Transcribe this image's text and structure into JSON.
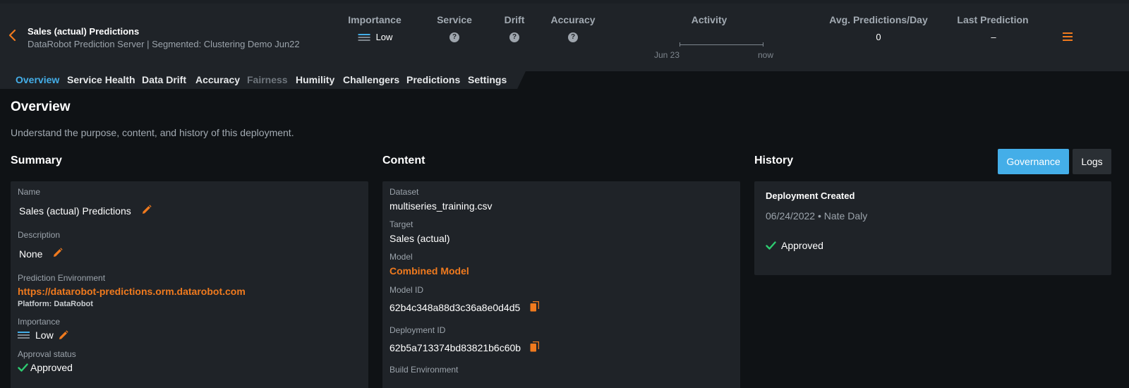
{
  "header": {
    "title": "Sales (actual) Predictions",
    "subtitle": "DataRobot Prediction Server | Segmented: Clustering Demo Jun22",
    "metrics": {
      "importance_label": "Importance",
      "importance_value": "Low",
      "service_label": "Service",
      "drift_label": "Drift",
      "accuracy_label": "Accuracy",
      "activity_label": "Activity",
      "activity_start": "Jun 23",
      "activity_end": "now",
      "avg_label": "Avg. Predictions/Day",
      "avg_value": "0",
      "last_label": "Last Prediction",
      "last_value": "–"
    }
  },
  "tabs": [
    {
      "label": "Overview",
      "state": "active"
    },
    {
      "label": "Service Health",
      "state": "normal"
    },
    {
      "label": "Data Drift",
      "state": "normal"
    },
    {
      "label": "Accuracy",
      "state": "normal"
    },
    {
      "label": "Fairness",
      "state": "disabled"
    },
    {
      "label": "Humility",
      "state": "normal"
    },
    {
      "label": "Challengers",
      "state": "normal"
    },
    {
      "label": "Predictions",
      "state": "normal"
    },
    {
      "label": "Settings",
      "state": "normal"
    }
  ],
  "page": {
    "title": "Overview",
    "description": "Understand the purpose, content, and history of this deployment."
  },
  "summary": {
    "heading": "Summary",
    "name_label": "Name",
    "name_value": "Sales (actual) Predictions",
    "description_label": "Description",
    "description_value": "None",
    "env_label": "Prediction Environment",
    "env_url": "https://datarobot-predictions.orm.datarobot.com",
    "env_platform": "Platform: DataRobot",
    "importance_label": "Importance",
    "importance_value": "Low",
    "approval_label": "Approval status",
    "approval_value": "Approved"
  },
  "content": {
    "heading": "Content",
    "dataset_label": "Dataset",
    "dataset_value": "multiseries_training.csv",
    "target_label": "Target",
    "target_value": "Sales (actual)",
    "model_label": "Model",
    "model_value": "Combined Model",
    "model_id_label": "Model ID",
    "model_id_value": "62b4c348a88d3c36a8e0d4d5",
    "deployment_id_label": "Deployment ID",
    "deployment_id_value": "62b5a713374bd83821b6c60b",
    "build_env_label": "Build Environment"
  },
  "history": {
    "heading": "History",
    "governance_label": "Governance",
    "logs_label": "Logs",
    "event_title": "Deployment Created",
    "event_meta": "06/24/2022 • Nate Daly",
    "event_status": "Approved"
  },
  "colors": {
    "accent_blue": "#44aee8",
    "accent_orange": "#f07a1e",
    "success_green": "#2ecc71",
    "panel_bg": "#1f2328",
    "page_bg": "#0f1215"
  },
  "icons": [
    "back-chevron-icon",
    "importance-bars-icon",
    "question-icon",
    "menu-icon",
    "pencil-icon",
    "copy-icon",
    "check-icon"
  ]
}
